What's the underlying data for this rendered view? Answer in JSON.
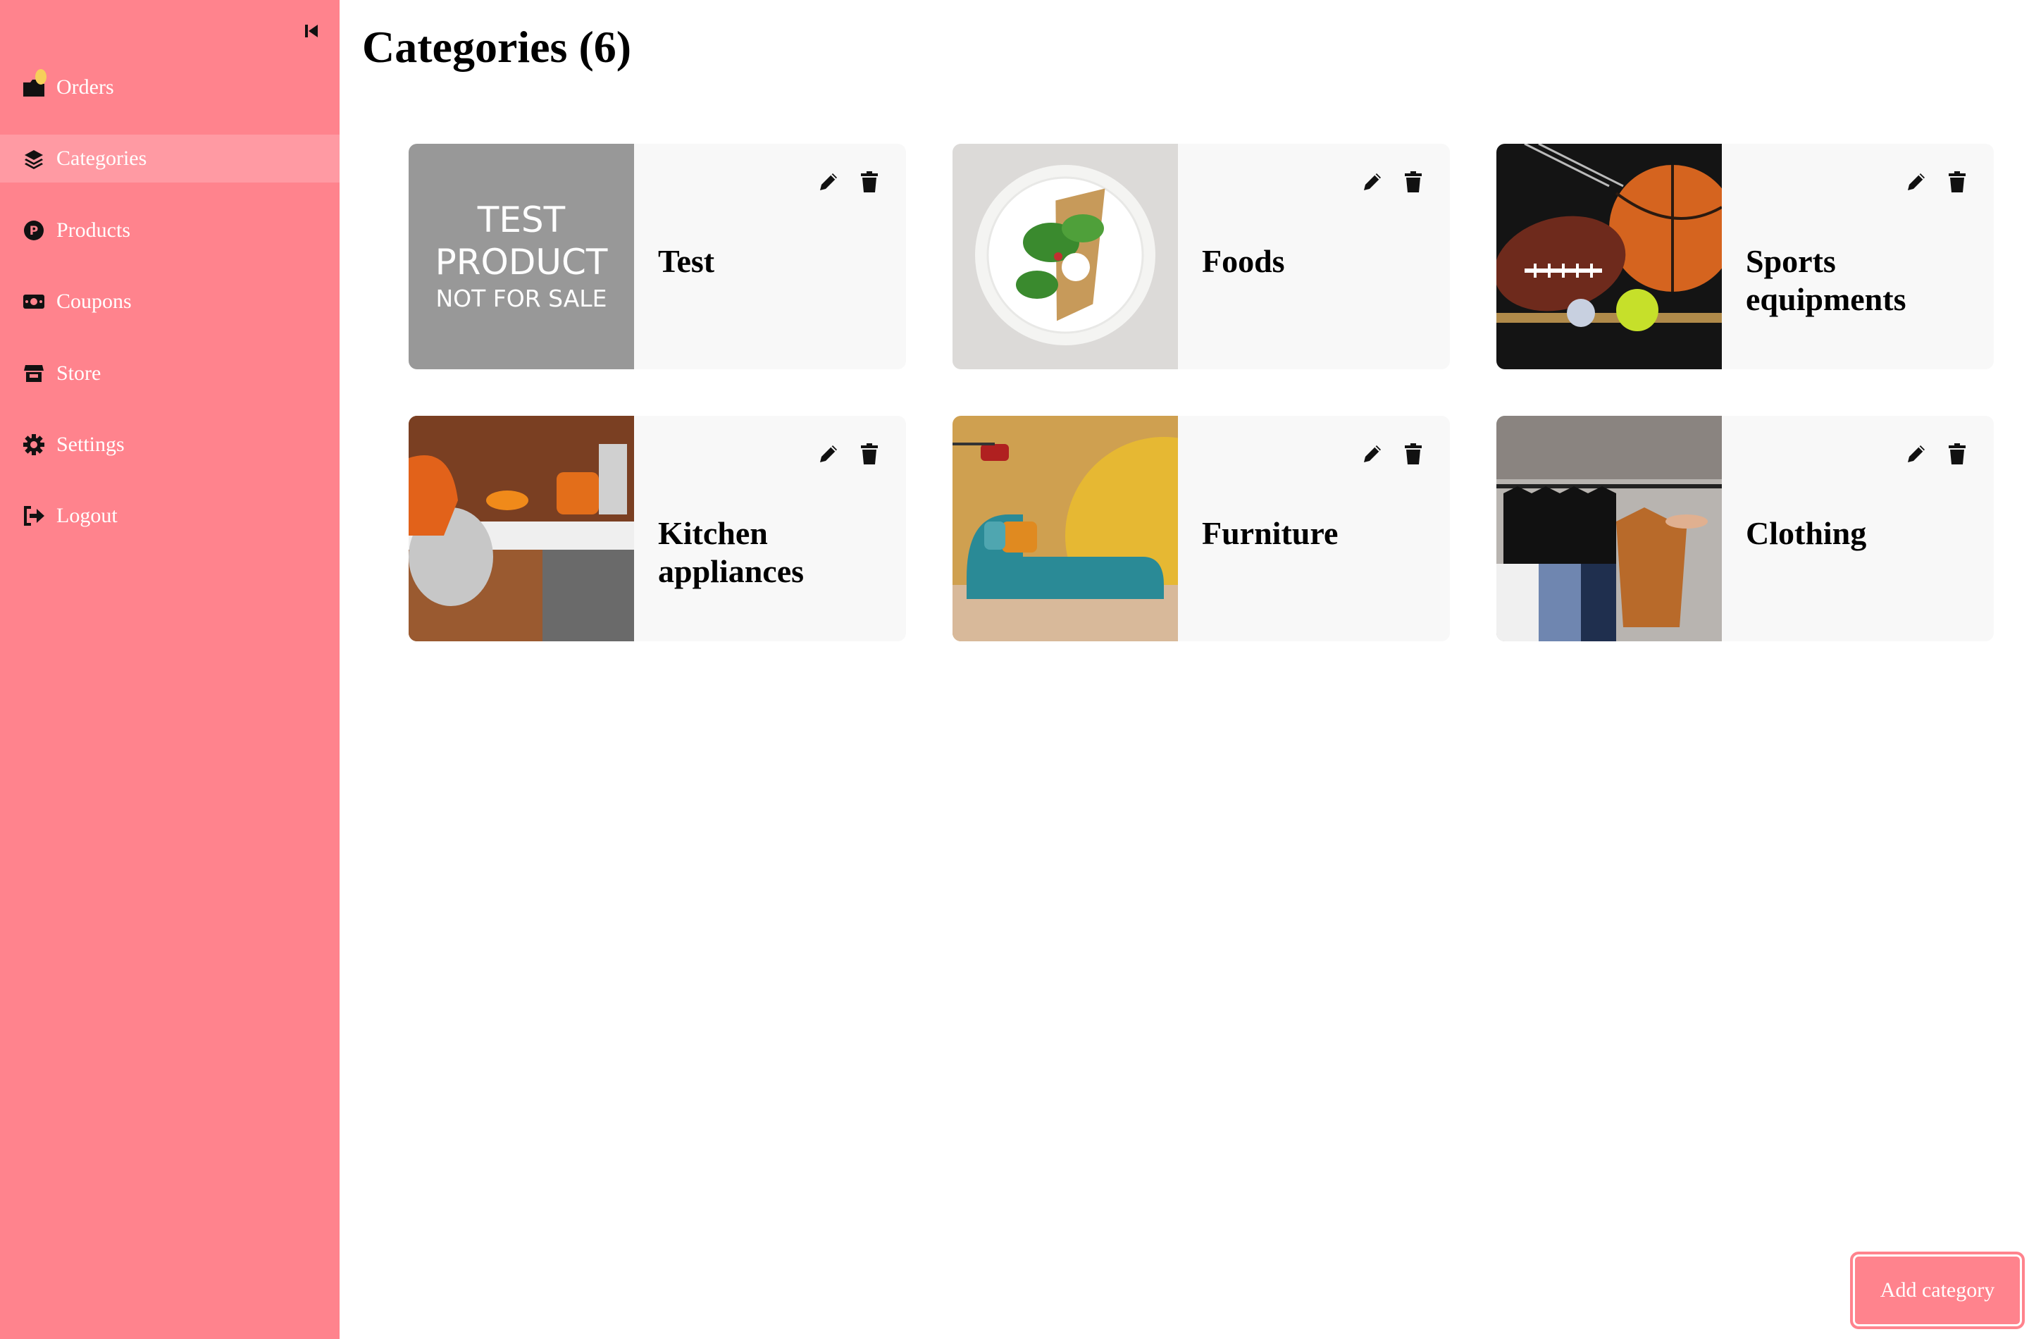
{
  "sidebar": {
    "items": [
      {
        "label": "Orders",
        "icon": "orders-icon",
        "active": false
      },
      {
        "label": "Categories",
        "icon": "layers-icon",
        "active": true
      },
      {
        "label": "Products",
        "icon": "product-p-icon",
        "active": false
      },
      {
        "label": "Coupons",
        "icon": "coupon-icon",
        "active": false
      },
      {
        "label": "Store",
        "icon": "store-icon",
        "active": false
      },
      {
        "label": "Settings",
        "icon": "gear-icon",
        "active": false
      },
      {
        "label": "Logout",
        "icon": "logout-icon",
        "active": false
      }
    ],
    "background": "#ff838d",
    "active_background": "#ff9aa3"
  },
  "main": {
    "title": "Categories (6)",
    "categories": [
      {
        "name": "Test",
        "image": "test-product-placeholder",
        "image_text": [
          "TEST",
          "PRODUCT",
          "NOT FOR SALE"
        ]
      },
      {
        "name": "Foods",
        "image": "food-plate-photo"
      },
      {
        "name": "Sports equipments",
        "image": "sports-balls-photo"
      },
      {
        "name": "Kitchen appliances",
        "image": "kitchen-mixer-photo"
      },
      {
        "name": "Furniture",
        "image": "teal-sofa-photo"
      },
      {
        "name": "Clothing",
        "image": "clothing-rack-photo"
      }
    ]
  },
  "actions": {
    "add_category_label": "Add category"
  }
}
